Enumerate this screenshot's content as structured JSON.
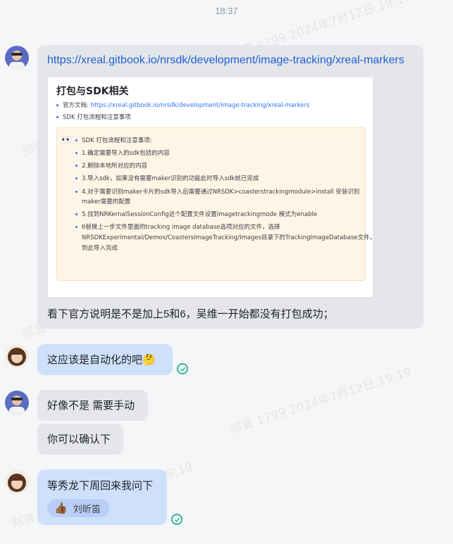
{
  "timestamp": "18:37",
  "watermark": "郑贤 1799 2024年7月12日 19:19",
  "messages": {
    "m1": {
      "link": "https://xreal.gitbook.io/nrsdk/development/image-tracking/xreal-markers",
      "card": {
        "title": "打包与SDK相关",
        "doc_label": "官方文档:",
        "doc_link": "https://xreal.gitbook.io/nrsdk/development/image-tracking/xreal-markers",
        "item2": "SDK 打包流程和注意事项",
        "callout_emoji": "👀",
        "callout_items": [
          "SDK 打包流程和注意事项:",
          "1.确定需要导入的sdk包括的内容",
          "2.删除本地所对应的内容",
          "3.导入sdk，如果没有需要maker识别的功能此时导入sdk就已完成",
          "4.对于需要识别maker卡片的sdk导入后需要通过NRSDK>coasterstrackingmodule>install 安装识别",
          "maker需要的配置",
          "5.找到NRKernalSessionConfig这个配置文件设置imagetrackingmode 模式为enable",
          "6替换上一步文件里面的tracking image database选项对应的文件，选择",
          "NRSDKExperimental/Demos/CoastersImageTracking/Images目录下的TrackingImageDatabase文件，",
          "到此导入完成"
        ]
      },
      "text": "看下官方说明是不是加上5和6，吴维一开始都没有打包成功；"
    },
    "m2": {
      "text": "这应该是自动化的吧🤔"
    },
    "m3": {
      "text": "好像不是 需要手动"
    },
    "m4": {
      "text": "你可以确认下"
    },
    "m5": {
      "text": "等秀龙下周回来我问下",
      "reaction_emoji": "👍🏾",
      "reaction_user": "刘昕笛"
    }
  }
}
